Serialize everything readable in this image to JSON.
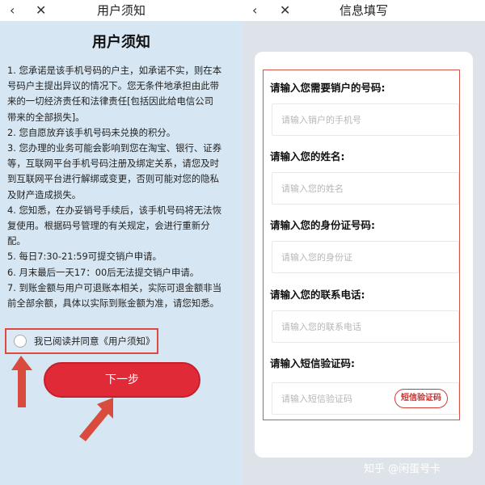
{
  "left_screen": {
    "nav": {
      "back_icon": "chevron-left-icon",
      "close_icon": "close-icon",
      "title": "用户须知"
    },
    "heading": "用户须知",
    "notice_lines": [
      "1. 您承诺是该手机号码的户主，如承诺不实，则在本",
      "号码户主提出异议的情况下。您无条件地承担由此带",
      "来的一切经济责任和法律责任[包括因此给电信公司",
      "带来的全部损失]。",
      "2. 您自愿放弃该手机号码未兑换的积分。",
      "3. 您办理的业务可能会影响到您在淘宝、银行、证券",
      "等，互联网平台手机号码注册及绑定关系，请您及时",
      "到互联网平台进行解绑或变更，否则可能对您的隐私",
      "及财产造成损失。",
      "4. 您知悉，在办妥销号手续后，该手机号码将无法恢",
      "复使用。根据码号管理的有关规定，会进行重新分",
      "配。",
      "5. 每日7:30-21:59可提交销户申请。",
      "6. 月末最后一天17：00后无法提交销户申请。",
      "7. 到账金额与用户可退账本相关，实际可退金额非当",
      "前全部余额，具体以实际到账金额为准，请您知悉。"
    ],
    "agree_label": "我已阅读并同意《用户须知》",
    "next_button": "下一步"
  },
  "right_screen": {
    "nav": {
      "back_icon": "chevron-left-icon",
      "close_icon": "close-icon",
      "title": "信息填写"
    },
    "fields": [
      {
        "label": "请输入您需要销户的号码:",
        "placeholder": "请输入销户的手机号"
      },
      {
        "label": "请输入您的姓名:",
        "placeholder": "请输入您的姓名"
      },
      {
        "label": "请输入您的身份证号码:",
        "placeholder": "请输入您的身份证"
      },
      {
        "label": "请输入您的联系电话:",
        "placeholder": "请输入您的联系电话"
      },
      {
        "label": "请输入短信验证码:",
        "placeholder": "请输入短信验证码"
      }
    ],
    "sms_button": "短信验证码",
    "watermark": "知乎 @闲蛋号卡"
  },
  "colors": {
    "accent_red": "#e12a38",
    "annotation_red": "#d94b3c",
    "left_bg": "#d6e6f2",
    "right_bg": "#dde3e8"
  }
}
